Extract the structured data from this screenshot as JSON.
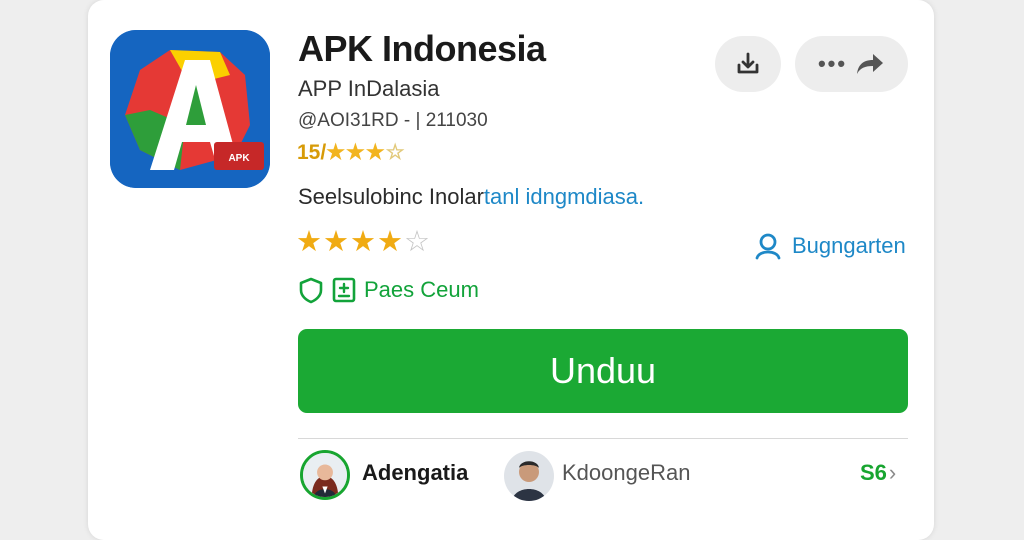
{
  "app": {
    "title": "APK Indonesia",
    "subtitle": "APP InDalasia",
    "meta": "@AOI31RD - | 211030",
    "rating_number": "15/",
    "rating_stars_full": "★★★",
    "rating_stars_empty": "☆"
  },
  "description": {
    "text": "Seelsulobinc Inolar",
    "link": "tanl idngmdiasa."
  },
  "rating": {
    "stars_full": "★★★★",
    "stars_empty": "☆",
    "value": 4,
    "max": 5
  },
  "follow": {
    "label": "Bugngarten"
  },
  "pass": {
    "label": "Paes Ceum"
  },
  "download": {
    "label": "Unduu"
  },
  "reviewers": [
    {
      "name": "Adengatia"
    },
    {
      "name": "KdoongeRan"
    }
  ],
  "reviewers_count": {
    "label": "S6",
    "chevron": "›"
  },
  "icons": {
    "install": "download-tray-icon",
    "more": "more-dots-icon",
    "share": "share-arrow-icon",
    "follow": "user-icon",
    "shield": "shield-icon",
    "pass": "document-icon"
  },
  "colors": {
    "primary_green": "#1ba934",
    "link_blue": "#1e88c7",
    "star_gold": "#f0ab13"
  }
}
